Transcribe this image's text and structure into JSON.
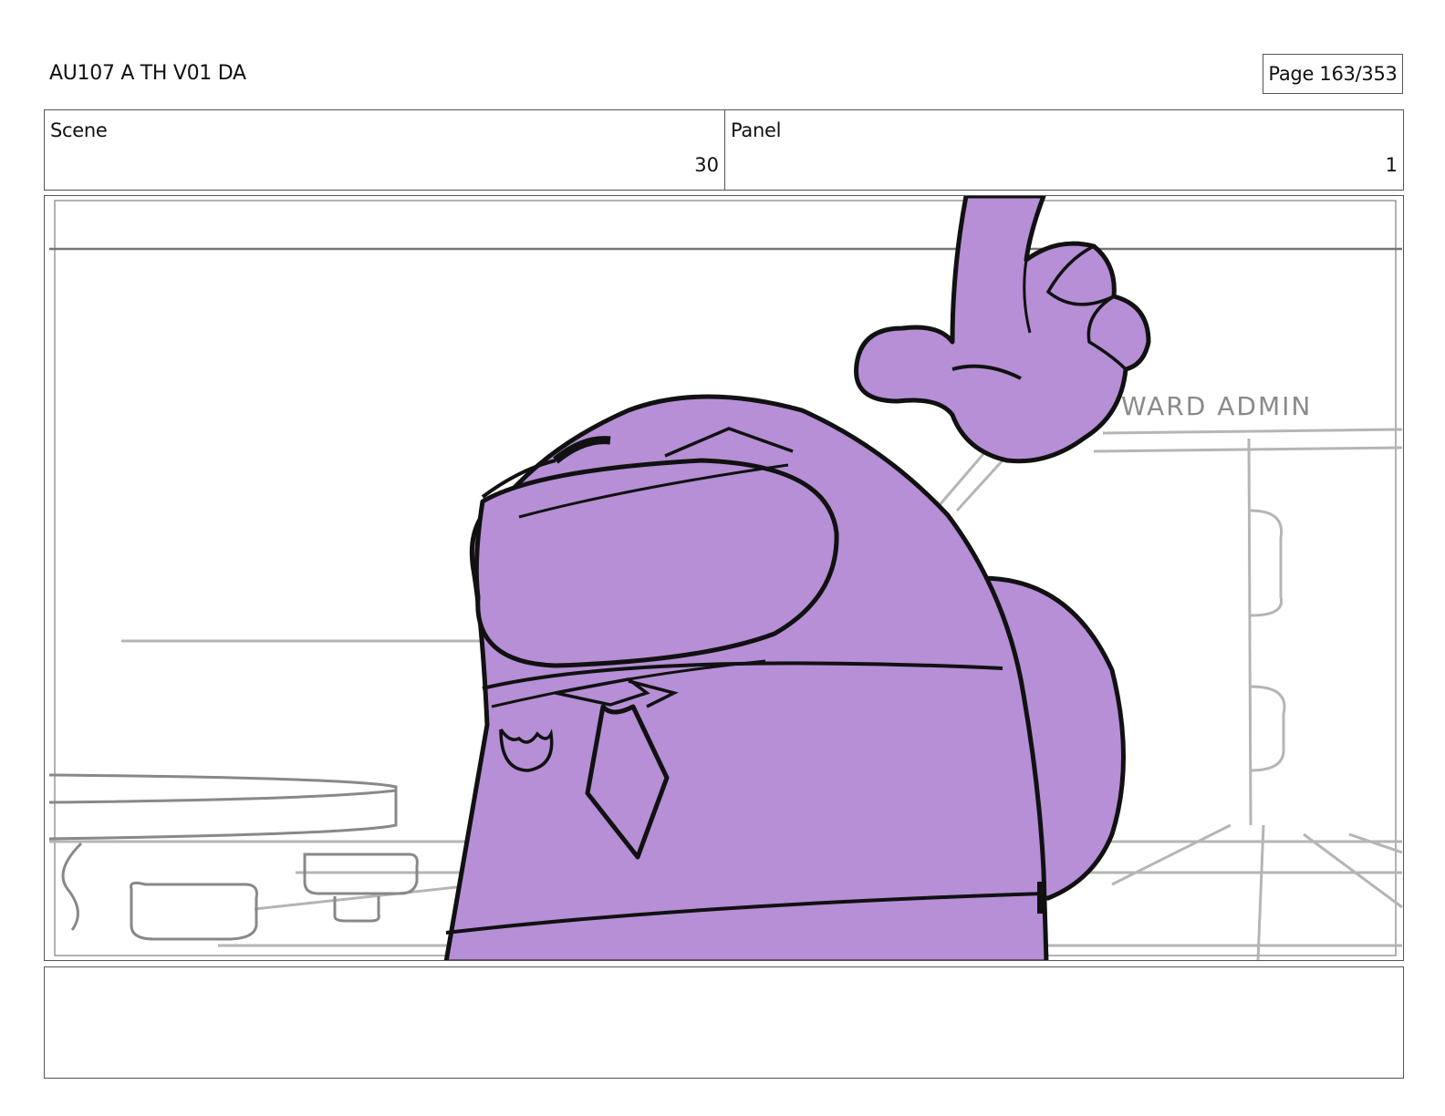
{
  "header": {
    "doc_title": "AU107 A TH V01 DA",
    "page_label": "Page 163/353"
  },
  "fields": {
    "scene_label": "Scene",
    "scene_value": "30",
    "panel_label": "Panel",
    "panel_value": "1"
  },
  "frame": {
    "sign_text": "WARD   ADMIN",
    "character_color": "#b68fd6",
    "line_color": "#111111",
    "background_line_color": "#b5b5b5"
  },
  "notes": {
    "text": ""
  }
}
